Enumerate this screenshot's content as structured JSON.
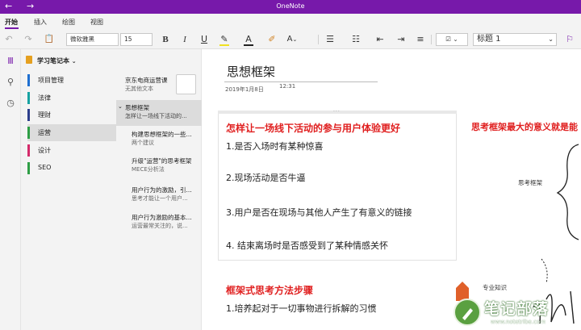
{
  "window": {
    "title": "OneNote",
    "back": "←",
    "forward": "→"
  },
  "menu": {
    "tabs": [
      "开始",
      "插入",
      "绘图",
      "视图"
    ]
  },
  "toolbar": {
    "font_name": "微软雅黑",
    "font_size": "15",
    "style_value": "标题 1",
    "bold": "B",
    "italic": "I",
    "underline": "U"
  },
  "notebook": {
    "name": "学习笔记本"
  },
  "sections": [
    {
      "label": "项目管理",
      "color": "#1e6fd0"
    },
    {
      "label": "法律",
      "color": "#17a2a2"
    },
    {
      "label": "理财",
      "color": "#2c3e8c"
    },
    {
      "label": "运营",
      "color": "#2e9e45"
    },
    {
      "label": "设计",
      "color": "#d42a6a"
    },
    {
      "label": "SEO",
      "color": "#2e9e45"
    }
  ],
  "pages": [
    {
      "title": "京东电商运营课",
      "subtitle": "无其他文本"
    },
    {
      "title": "思想框架",
      "subtitle": "怎样让一场线下活动的..."
    },
    {
      "title": "构建思想框架的一些...",
      "subtitle": "两个建议"
    },
    {
      "title": "升级\"运营\"的思考框架",
      "subtitle": "MECE分析法"
    },
    {
      "title": "用户行为的激励，引...",
      "subtitle": "思考才能让一个用户..."
    },
    {
      "title": "用户行为激励的基本...",
      "subtitle": "运营最常关注的，说..."
    }
  ],
  "canvas": {
    "page_title": "思想框架",
    "date": "2019年1月8日",
    "time": "12:31",
    "heading1": "怎样让一场线下活动的参与用户体验更好",
    "items": [
      "1.是否入场时有某种惊喜",
      "2.现场活动是否牛逼",
      "3.用户是否在现场与其他人产生了有意义的链接",
      "4. 结束离场时是否感受到了某种情感关怀"
    ],
    "heading2": "框架式思考方法步骤",
    "step1": "1.培养起对于一切事物进行拆解的习惯",
    "right_heading": "思考框架最大的意义就是能",
    "label_framework": "思考框架",
    "label_knowledge": "专业知识"
  },
  "watermark": {
    "text": "笔记部落",
    "url": "www.notetribe.com"
  },
  "colors": {
    "accent": "#7719aa",
    "heading_red": "#e02020"
  }
}
